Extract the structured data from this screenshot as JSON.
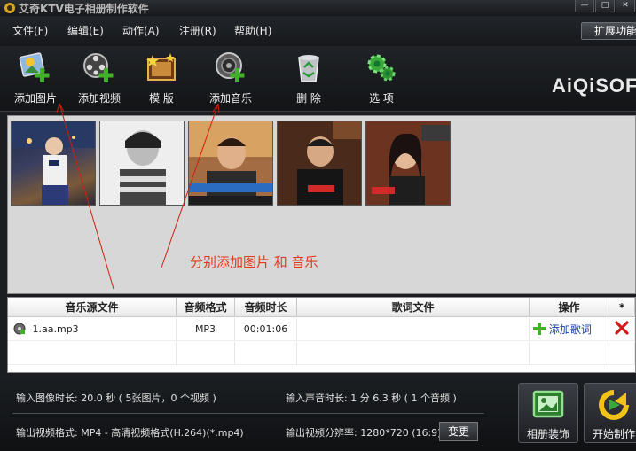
{
  "window": {
    "title": "艾奇KTV电子相册制作软件"
  },
  "menu": [
    {
      "label": "文件(F)"
    },
    {
      "label": "编辑(E)"
    },
    {
      "label": "动作(A)"
    },
    {
      "label": "注册(R)"
    },
    {
      "label": "帮助(H)"
    }
  ],
  "extend_button": "扩展功能",
  "toolbar": [
    {
      "label": "添加图片",
      "icon": "add-image-icon"
    },
    {
      "label": "添加视频",
      "icon": "add-video-icon"
    },
    {
      "label": "模 版",
      "icon": "template-icon"
    },
    {
      "label": "添加音乐",
      "icon": "add-music-icon"
    },
    {
      "label": "删 除",
      "icon": "recycle-bin-icon"
    },
    {
      "label": "选 项",
      "icon": "options-icon"
    }
  ],
  "logo": "AiQiSOF",
  "images": [
    {
      "icon": "photo-thumbnail"
    },
    {
      "icon": "photo-thumbnail"
    },
    {
      "icon": "photo-thumbnail"
    },
    {
      "icon": "photo-thumbnail"
    },
    {
      "icon": "photo-thumbnail"
    }
  ],
  "annotation": "分别添加图片  和  音乐",
  "table": {
    "headers": [
      "音乐源文件",
      "音频格式",
      "音频时长",
      "歌词文件",
      "操作",
      "*"
    ],
    "rows": [
      {
        "file": "1.aa.mp3",
        "format": "MP3",
        "duration": "00:01:06",
        "lyrics": "",
        "action": "添加歌词"
      }
    ]
  },
  "info": {
    "input_image_duration": "输入图像时长: 20.0 秒 ( 5张图片，0 个视频 )",
    "input_audio_duration": "输入声音时长: 1 分 6.3 秒 ( 1 个音频 )",
    "output_format": "输出视频格式: MP4 - 高清视频格式(H.264)(*.mp4)",
    "output_resolution": "输出视频分辨率: 1280*720 (16:9)",
    "change_button": "变更"
  },
  "buttons": {
    "album_decor": "相册装饰",
    "start": "开始制作"
  },
  "colors": {
    "annotation": "#e03a1b",
    "plus_green": "#43b02a",
    "delete_red": "#d11a1a"
  }
}
